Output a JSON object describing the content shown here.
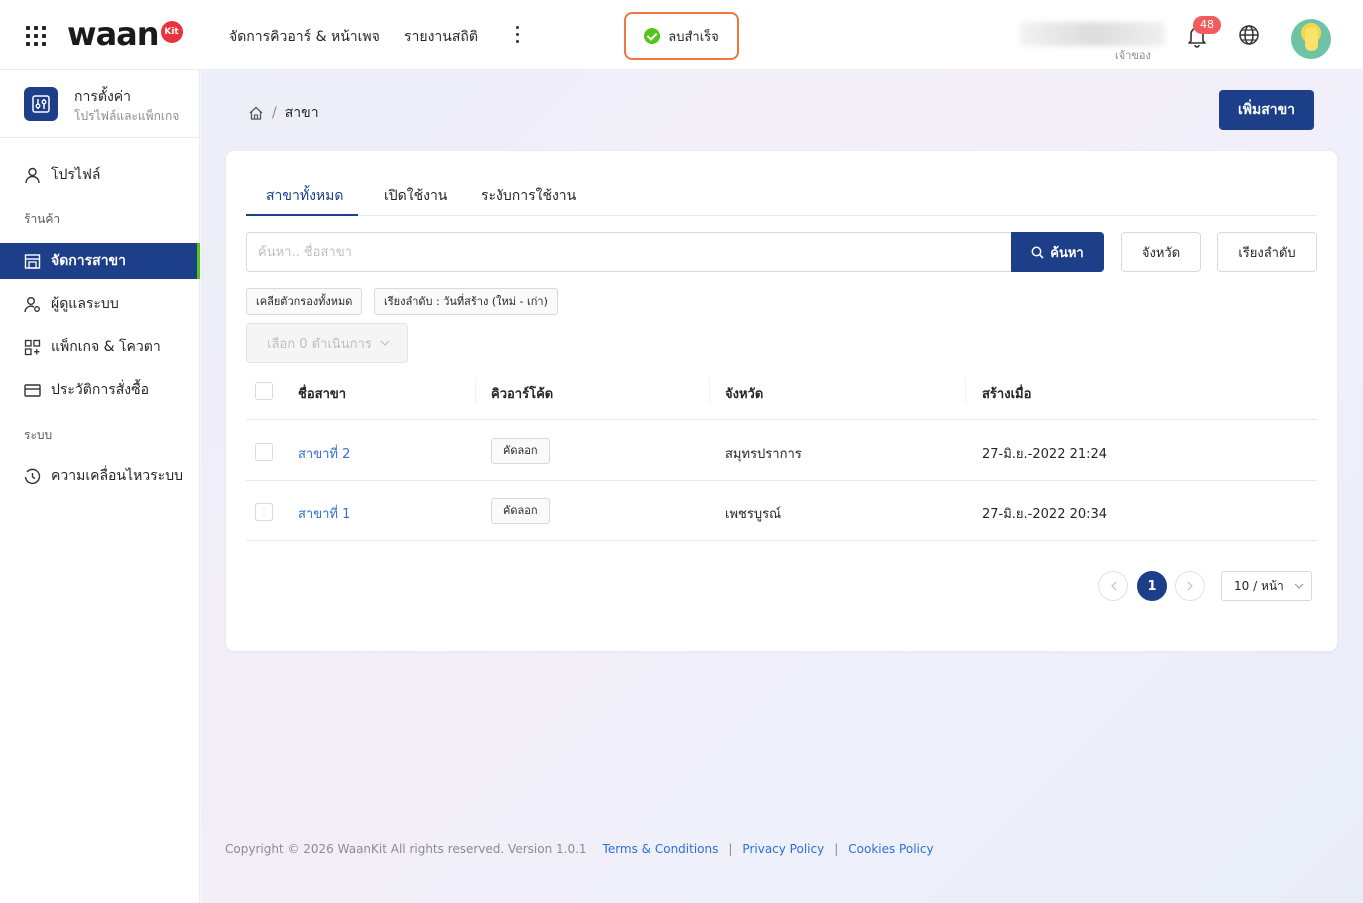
{
  "header": {
    "logo_text": "waan",
    "logo_badge": "Kit",
    "nav": [
      "จัดการคิวอาร์ & หน้าเพจ",
      "รายงานสถิติ"
    ],
    "toast": "ลบสำเร็จ",
    "user_role": "เจ้าของ",
    "notification_count": "48"
  },
  "sidebar": {
    "settings_title": "การตั้งค่า",
    "settings_subtitle": "โปรไฟล์และแพ็กเกจ",
    "items": [
      {
        "label": "โปรไฟล์",
        "icon": "user-icon"
      },
      {
        "label": "จัดการสาขา",
        "icon": "store-icon"
      },
      {
        "label": "ผู้ดูแลระบบ",
        "icon": "admin-icon"
      },
      {
        "label": "แพ็กเกจ & โควตา",
        "icon": "package-icon"
      },
      {
        "label": "ประวัติการสั่งซื้อ",
        "icon": "card-icon"
      },
      {
        "label": "ความเคลื่อนไหวระบบ",
        "icon": "history-icon"
      }
    ],
    "sections": [
      "ร้านค้า",
      "ระบบ"
    ]
  },
  "main": {
    "breadcrumb_current": "สาขา",
    "add_button": "เพิ่มสาขา",
    "tabs": [
      "สาขาทั้งหมด",
      "เปิดใช้งาน",
      "ระงับการใช้งาน"
    ],
    "search_placeholder": "ค้นหา.. ชื่อสาขา",
    "search_button": "ค้นหา",
    "province_button": "จังหวัด",
    "sort_button": "เรียงลำดับ",
    "chips": [
      "เคลียตัวกรองทั้งหมด",
      "เรียงลำดับ : วันที่สร้าง (ใหม่ - เก่า)"
    ],
    "bulk_action": "เลือก 0 ดำเนินการ",
    "columns": [
      "ชื่อสาขา",
      "คิวอาร์โค้ด",
      "จังหวัด",
      "สร้างเมื่อ"
    ],
    "rows": [
      {
        "name": "สาขาที่ 2",
        "qr": "คัดลอก",
        "province": "สมุทรปราการ",
        "created": "27-มิ.ย.-2022 21:24"
      },
      {
        "name": "สาขาที่ 1",
        "qr": "คัดลอก",
        "province": "เพชรบูรณ์",
        "created": "27-มิ.ย.-2022 20:34"
      }
    ],
    "pagination": {
      "current": "1",
      "page_size": "10 / หน้า"
    }
  },
  "footer": {
    "copyright": "Copyright © 2026 WaanKit All rights reserved. Version 1.0.1",
    "links": [
      "Terms & Conditions",
      "Privacy Policy",
      "Cookies Policy"
    ]
  },
  "colors": {
    "primary": "#1d3f8a",
    "accent_green": "#52c41a",
    "toast_border": "#f0773e",
    "link": "#2f6fd6",
    "badge": "#f25c5c"
  }
}
